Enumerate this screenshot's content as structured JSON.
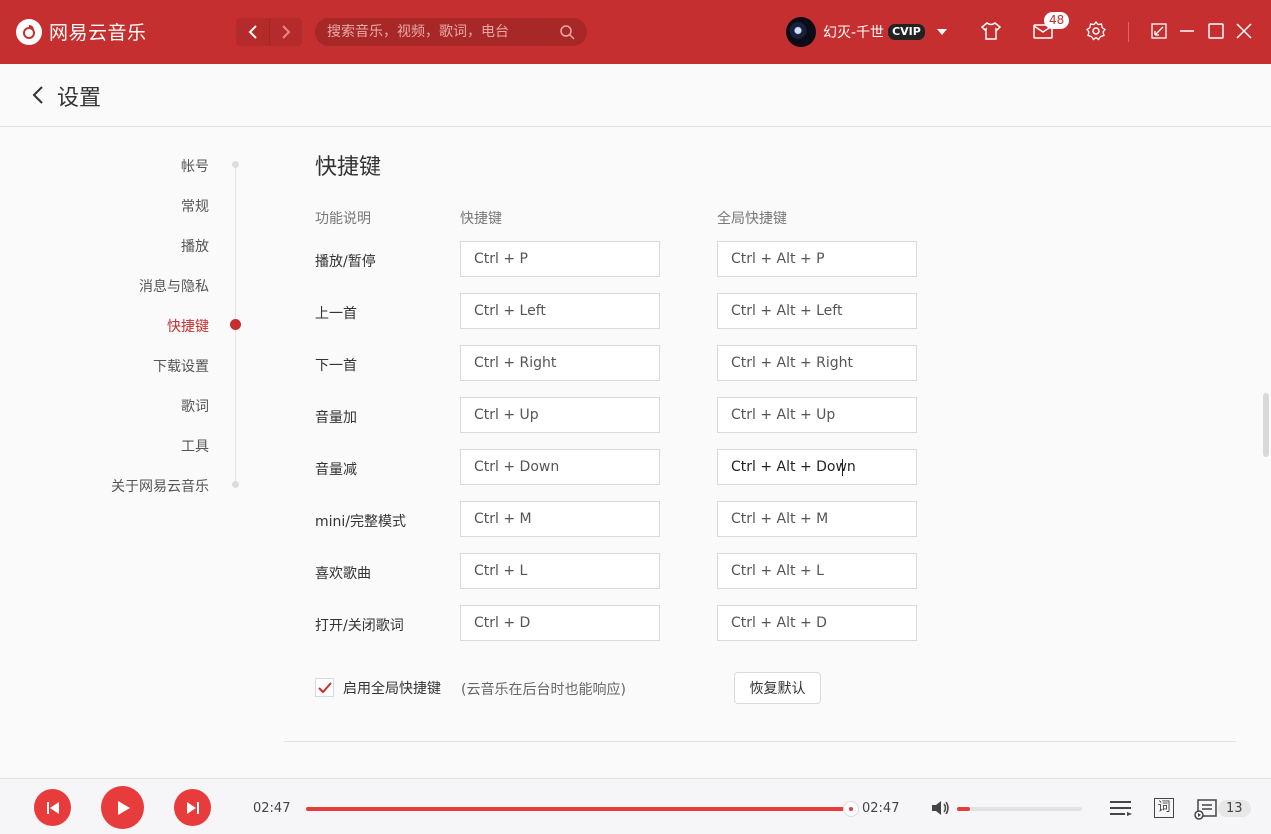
{
  "app": {
    "name": "网易云音乐",
    "search_placeholder": "搜索音乐，视频，歌词，电台",
    "user": {
      "name": "幻灭-千世",
      "vip": "CVIP"
    },
    "message_count": "48"
  },
  "header": {
    "title": "设置"
  },
  "sidenav": {
    "items": [
      "帐号",
      "常规",
      "播放",
      "消息与隐私",
      "快捷键",
      "下载设置",
      "歌词",
      "工具",
      "关于网易云音乐"
    ],
    "active": "快捷键"
  },
  "shortcuts": {
    "title": "快捷键",
    "columns": {
      "function": "功能说明",
      "shortcut": "快捷键",
      "global": "全局快捷键"
    },
    "rows": [
      {
        "label": "播放/暂停",
        "shortcut": "Ctrl + P",
        "global": "Ctrl + Alt + P"
      },
      {
        "label": "上一首",
        "shortcut": "Ctrl + Left",
        "global": "Ctrl + Alt + Left"
      },
      {
        "label": "下一首",
        "shortcut": "Ctrl + Right",
        "global": "Ctrl + Alt + Right"
      },
      {
        "label": "音量加",
        "shortcut": "Ctrl + Up",
        "global": "Ctrl + Alt + Up"
      },
      {
        "label": "音量减",
        "shortcut": "Ctrl + Down",
        "global": "Ctrl + Alt + Down"
      },
      {
        "label": "mini/完整模式",
        "shortcut": "Ctrl + M",
        "global": "Ctrl + Alt + M"
      },
      {
        "label": "喜欢歌曲",
        "shortcut": "Ctrl + L",
        "global": "Ctrl + Alt + L"
      },
      {
        "label": "打开/关闭歌词",
        "shortcut": "Ctrl + D",
        "global": "Ctrl + Alt + D"
      }
    ],
    "enable_global_label": "启用全局快捷键",
    "enable_global_checked": true,
    "enable_global_hint": "(云音乐在后台时也能响应)",
    "restore_label": "恢复默认"
  },
  "player": {
    "current_time": "02:47",
    "total_time": "02:47",
    "progress": 1.0,
    "volume": 0.1,
    "lyrics_label": "词",
    "queue_count": "13"
  },
  "colors": {
    "brand": "#c62f2f",
    "accent": "#e83c3c"
  }
}
